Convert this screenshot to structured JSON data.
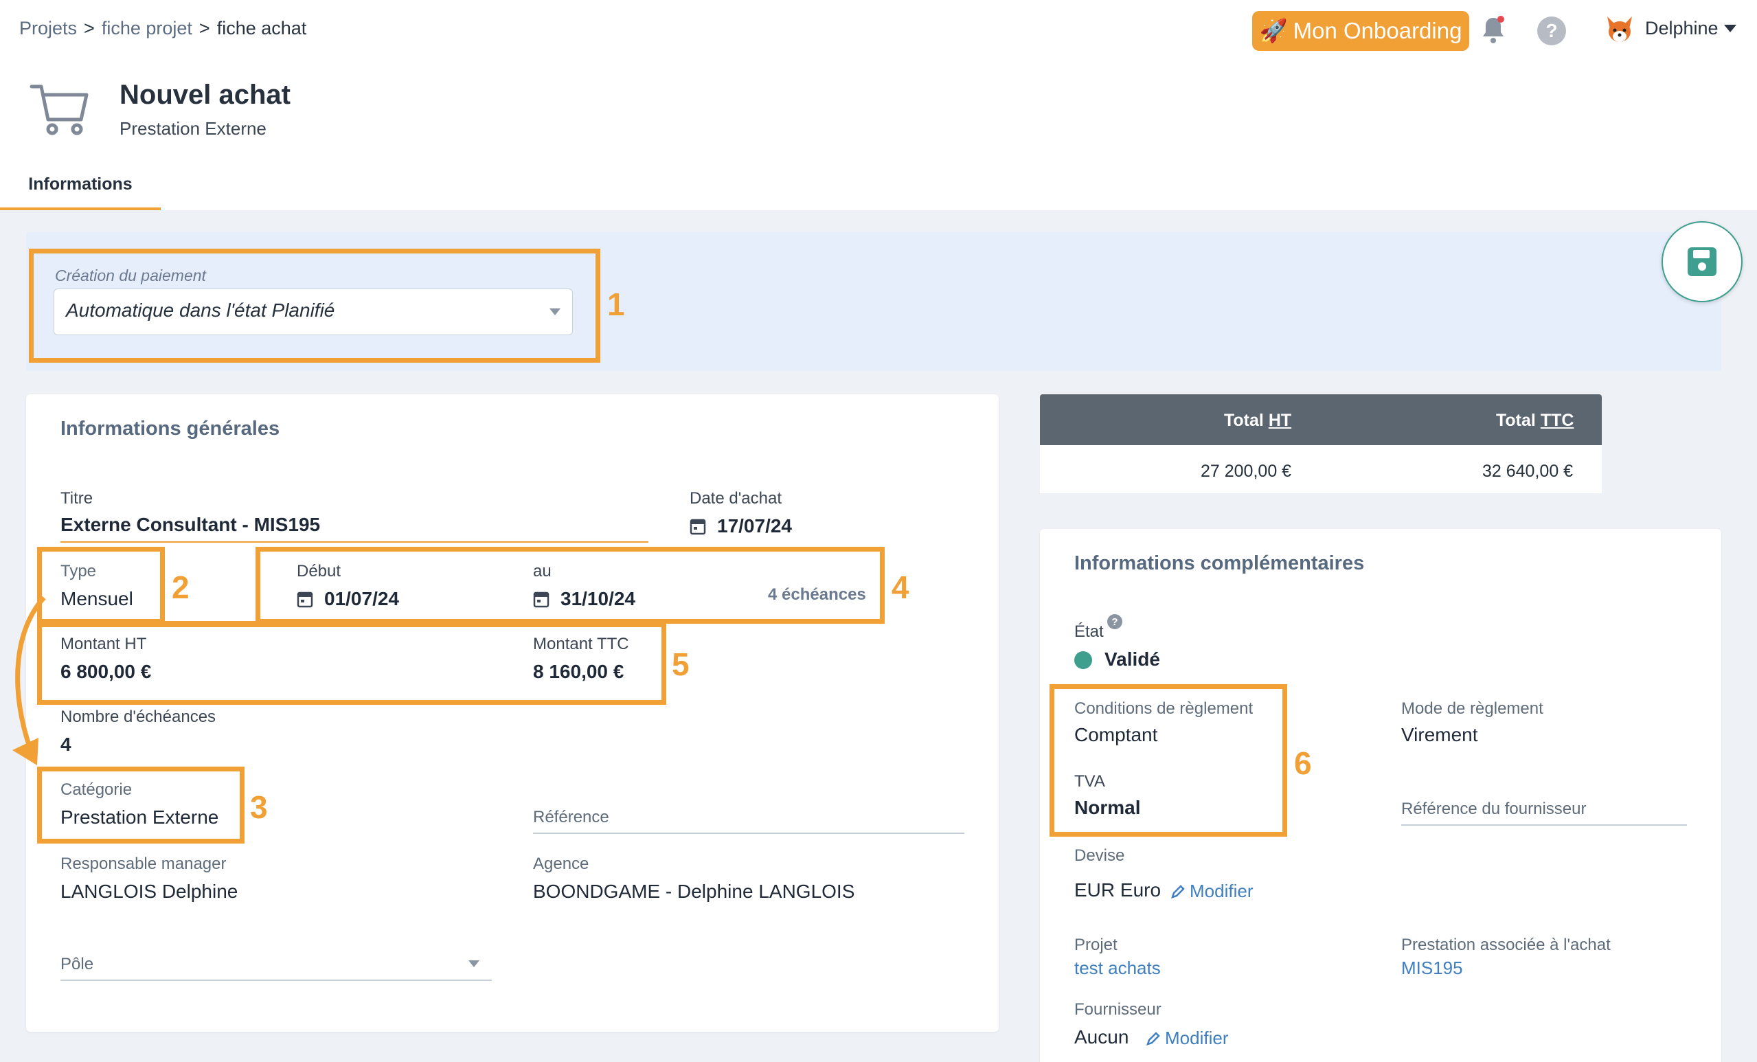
{
  "breadcrumb": {
    "item1": "Projets",
    "item2": "fiche projet",
    "item3": "fiche achat",
    "sep": ">"
  },
  "header": {
    "onboarding_label": "Mon Onboarding",
    "onboarding_emoji": "🚀",
    "help_label": "?",
    "user_name": "Delphine"
  },
  "page": {
    "title": "Nouvel achat",
    "subtitle": "Prestation Externe"
  },
  "tabs": [
    {
      "label": "Informations"
    }
  ],
  "payment": {
    "label": "Création du paiement",
    "value": "Automatique dans l'état Planifié"
  },
  "totals": {
    "ht_prefix": "Total ",
    "ht_abbr": "HT",
    "ttc_prefix": "Total ",
    "ttc_abbr": "TTC",
    "ht_value": "27 200,00 €",
    "ttc_value": "32 640,00 €"
  },
  "general": {
    "title": "Informations générales",
    "titre_label": "Titre",
    "titre_value": "Externe Consultant - MIS195",
    "date_label": "Date d'achat",
    "date_value": "17/07/24",
    "type_label": "Type",
    "type_value": "Mensuel",
    "debut_label": "Début",
    "debut_value": "01/07/24",
    "au_label": "au",
    "au_value": "31/10/24",
    "echeances_note": "4 échéances",
    "montant_ht_label": "Montant HT",
    "montant_ht_value": "6 800,00 €",
    "montant_ttc_label": "Montant TTC",
    "montant_ttc_value": "8 160,00 €",
    "nb_echeances_label": "Nombre d'échéances",
    "nb_echeances_value": "4",
    "categorie_label": "Catégorie",
    "categorie_value": "Prestation Externe",
    "reference_placeholder": "Référence",
    "manager_label": "Responsable manager",
    "manager_value": "LANGLOIS Delphine",
    "agence_label": "Agence",
    "agence_value": "BOONDGAME - Delphine LANGLOIS",
    "pole_placeholder": "Pôle"
  },
  "complementary": {
    "title": "Informations complémentaires",
    "etat_label": "État",
    "etat_value": "Validé",
    "conditions_label": "Conditions de règlement",
    "conditions_value": "Comptant",
    "mode_label": "Mode de règlement",
    "mode_value": "Virement",
    "tva_label": "TVA",
    "tva_value": "Normal",
    "ref_fournisseur_placeholder": "Référence du fournisseur",
    "devise_label": "Devise",
    "devise_value": "EUR Euro",
    "modifier_label": "Modifier",
    "projet_label": "Projet",
    "projet_value": "test achats",
    "prestation_label": "Prestation associée à l'achat",
    "prestation_value": "MIS195",
    "fournisseur_label": "Fournisseur",
    "fournisseur_value": "Aucun"
  },
  "annotations": {
    "n1": "1",
    "n2": "2",
    "n3": "3",
    "n4": "4",
    "n5": "5",
    "n6": "6"
  },
  "colors": {
    "accent_orange": "#f0a035",
    "status_green": "#3f9f8f",
    "link_blue": "#3f7fbf"
  },
  "icons": [
    "cart-icon",
    "bell-icon",
    "help-icon",
    "calendar-icon",
    "save-icon",
    "pencil-icon",
    "caret-down-icon"
  ]
}
